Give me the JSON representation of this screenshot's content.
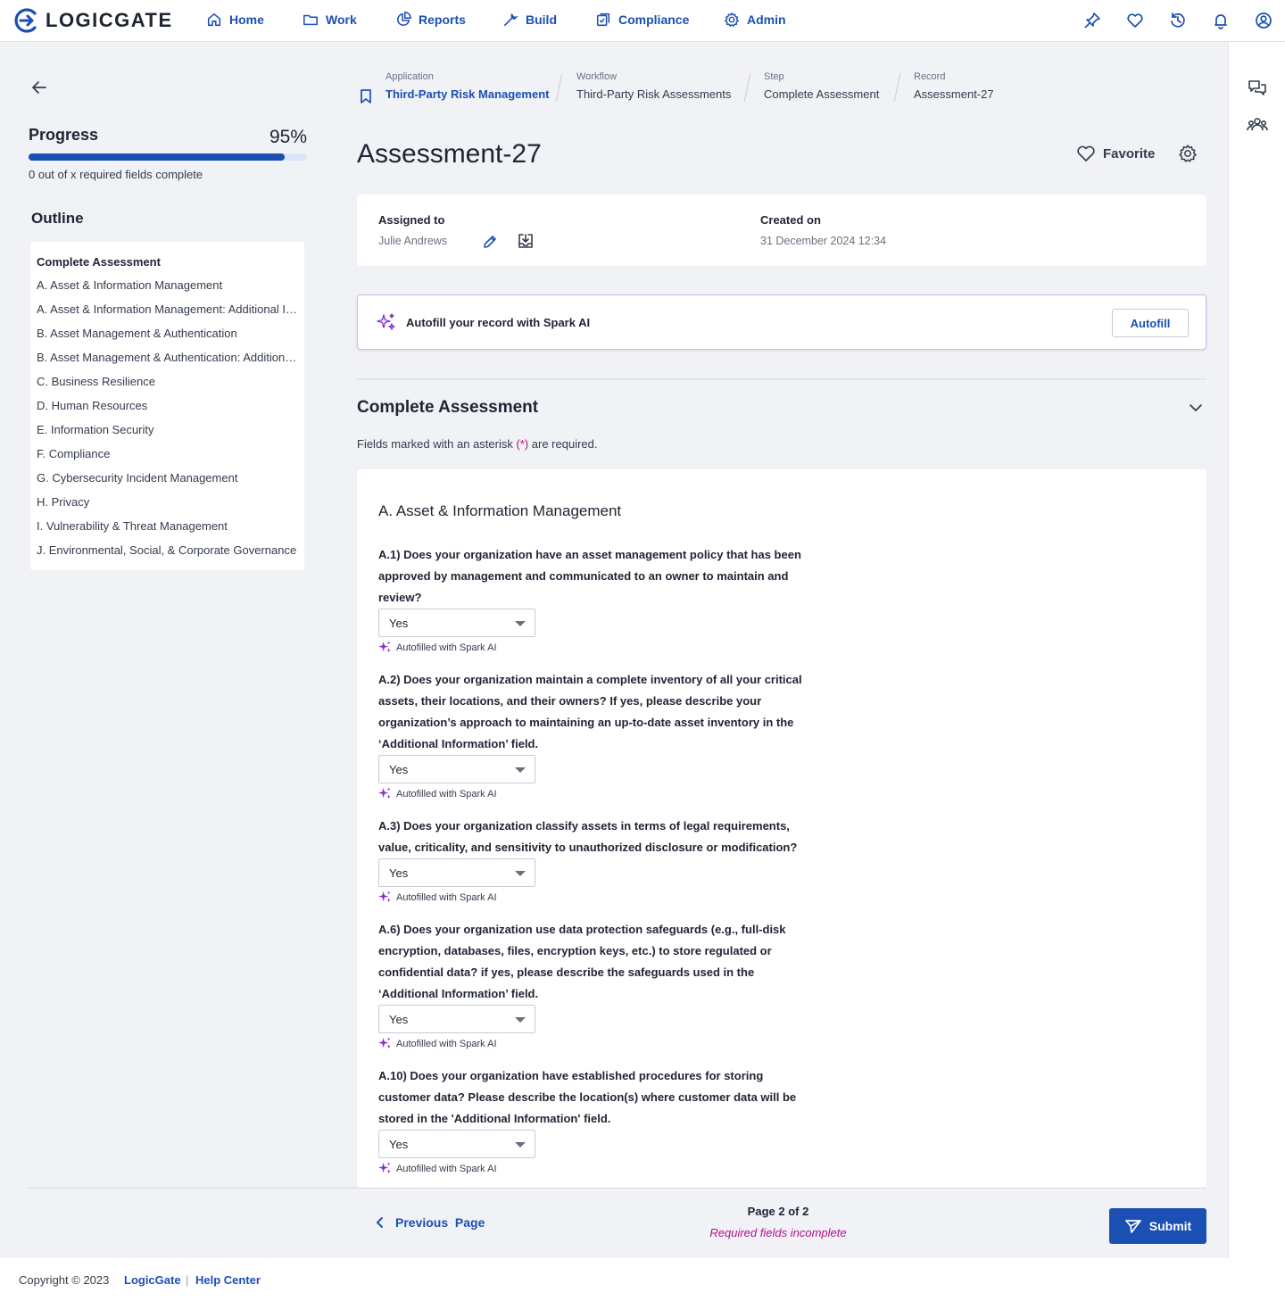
{
  "brand": {
    "name": "LOGICGATE"
  },
  "nav": {
    "items": [
      {
        "label": "Home",
        "icon": "home-icon"
      },
      {
        "label": "Work",
        "icon": "folder-icon"
      },
      {
        "label": "Reports",
        "icon": "pie-chart-icon"
      },
      {
        "label": "Build",
        "icon": "wrench-icon"
      },
      {
        "label": "Compliance",
        "icon": "checklist-icon"
      },
      {
        "label": "Admin",
        "icon": "gear-icon"
      }
    ],
    "right_icons": [
      "pin-icon",
      "heart-icon",
      "history-icon",
      "bell-icon",
      "user-circle-icon"
    ]
  },
  "rail": {
    "icons": [
      "chat-icon",
      "users-icon"
    ]
  },
  "progress": {
    "title": "Progress",
    "percent_label": "95%",
    "value": 0.92,
    "subtitle": "0 out of x required fields complete"
  },
  "outline": {
    "title": "Outline",
    "heading": "Complete Assessment",
    "items": [
      "A. Asset & Information Management",
      "A. Asset & Information Management: Additional Information",
      "B. Asset Management & Authentication",
      "B. Asset Management & Authentication: Additional Information",
      "C. Business Resilience",
      "D. Human Resources",
      "E. Information Security",
      "F. Compliance",
      "G. Cybersecurity Incident Management",
      "H. Privacy",
      "I. Vulnerability & Threat Management",
      "J. Environmental, Social, & Corporate Governance"
    ]
  },
  "breadcrumb": {
    "application": {
      "label": "Application",
      "value": "Third-Party Risk Management"
    },
    "workflow": {
      "label": "Workflow",
      "value": "Third-Party Risk Assessments"
    },
    "step": {
      "label": "Step",
      "value": "Complete Assessment"
    },
    "record": {
      "label": "Record",
      "value": "Assessment-27"
    }
  },
  "record": {
    "title": "Assessment-27",
    "favorite_label": "Favorite",
    "assigned_label": "Assigned to",
    "assigned_value": "Julie Andrews",
    "created_label": "Created on",
    "created_value": "31 December 2024 12:34"
  },
  "autofill": {
    "text": "Autofill your record with Spark AI",
    "button": "Autofill"
  },
  "section": {
    "title": "Complete Assessment",
    "note_pre": "Fields marked with an asterisk ",
    "note_ast": "(*)",
    "note_post": " are required.",
    "subsection": "A. Asset & Information Management"
  },
  "questions": [
    {
      "text": "A.1) Does your organization have an asset management policy that has been approved by management and communicated to an owner to maintain and review?",
      "value": "Yes",
      "autofill_note": "Autofilled with Spark AI"
    },
    {
      "text": "A.2) Does your organization maintain a complete inventory of all your critical assets, their locations, and their owners? If yes, please describe your organization’s approach to maintaining an up-to-date asset inventory in the ‘Additional Information’ field.",
      "value": "Yes",
      "autofill_note": "Autofilled with Spark AI"
    },
    {
      "text": "A.3) Does your organization classify assets in terms of legal requirements, value, criticality, and sensitivity to unauthorized disclosure or modification?",
      "value": "Yes",
      "autofill_note": "Autofilled with Spark AI"
    },
    {
      "text": "A.6) Does your organization use data protection safeguards (e.g., full-disk encryption, databases, files, encryption keys, etc.) to store regulated or confidential data? if yes, please describe the safeguards used in the ‘Additional Information’ field.",
      "value": "Yes",
      "autofill_note": "Autofilled with Spark AI"
    },
    {
      "text": "A.10) Does your organization have established procedures for storing customer data? Please describe the location(s) where customer data will be stored in the 'Additional Information' field.",
      "value": "Yes",
      "autofill_note": "Autofilled with Spark AI"
    }
  ],
  "pager": {
    "prev_label": "Previous",
    "prev_label2": "Page",
    "page_label": "Page 2 of 2",
    "status": "Required fields incomplete",
    "submit": "Submit"
  },
  "footer": {
    "copyright": "Copyright © 2023",
    "link1": "LogicGate",
    "separator": "|",
    "link2": "Help Center"
  },
  "colors": {
    "primary": "#1b4fb3",
    "accent": "#b0108a",
    "spark": "#8a2bd0"
  }
}
